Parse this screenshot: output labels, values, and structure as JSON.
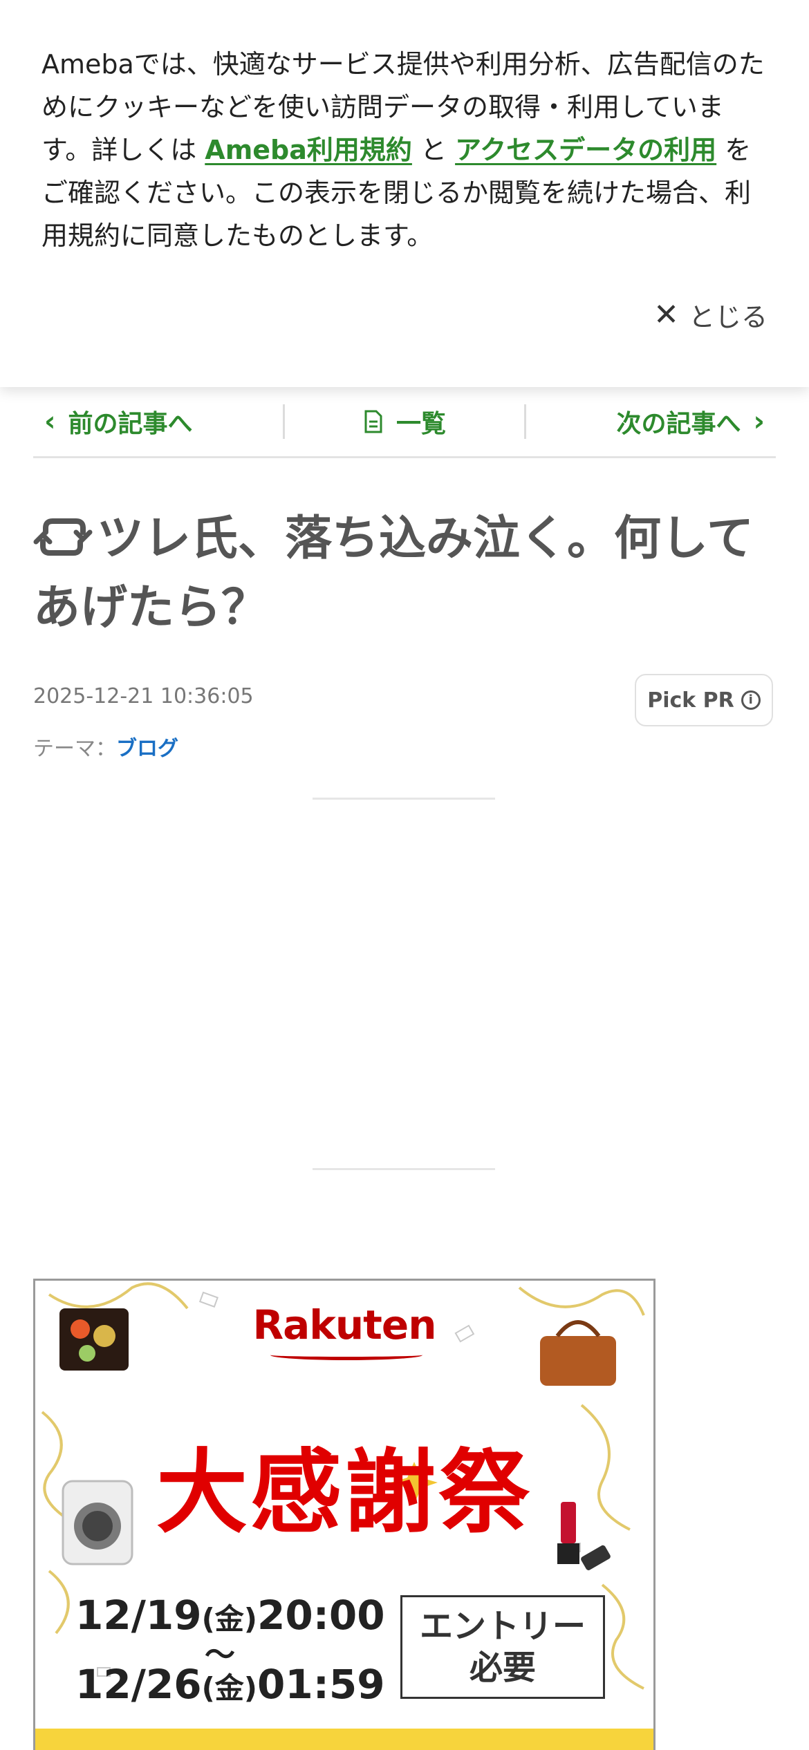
{
  "cookie_banner": {
    "text_before": "Amebaでは、快適なサービス提供や利用分析、広告配信のためにクッキーなどを使い訪問データの取得・利用しています。詳しくは ",
    "link_terms": "Ameba利用規約",
    "text_and": " と ",
    "link_access": "アクセスデータの利用",
    "text_after": " をご確認ください。この表示を閉じるか閲覧を続けた場合、利用規約に同意したものとします。",
    "close_label": "とじる"
  },
  "nav": {
    "prev_label": "前の記事へ",
    "list_label": "一覧",
    "next_label": "次の記事へ"
  },
  "article": {
    "title": "ツレ氏、落ち込み泣く。何してあげたら？",
    "date": "2025-12-21 10:36:05",
    "theme_prefix": "テーマ：",
    "theme_link": "ブログ",
    "pick_pr_label": "Pick PR"
  },
  "ad": {
    "logo": "Rakuten",
    "headline": "大感謝祭",
    "date_start": "12/19",
    "day_start": "(金)",
    "time_start": "20:00",
    "tilde": "〜",
    "date_end": "12/26",
    "day_end": "(金)",
    "time_end": "01:59",
    "entry_line1": "エントリー",
    "entry_line2": "必要"
  },
  "colors": {
    "accent_green": "#2d8a2d",
    "link_blue": "#1a6fc4",
    "rakuten_red": "#bf0000",
    "headline_red": "#e00000"
  }
}
